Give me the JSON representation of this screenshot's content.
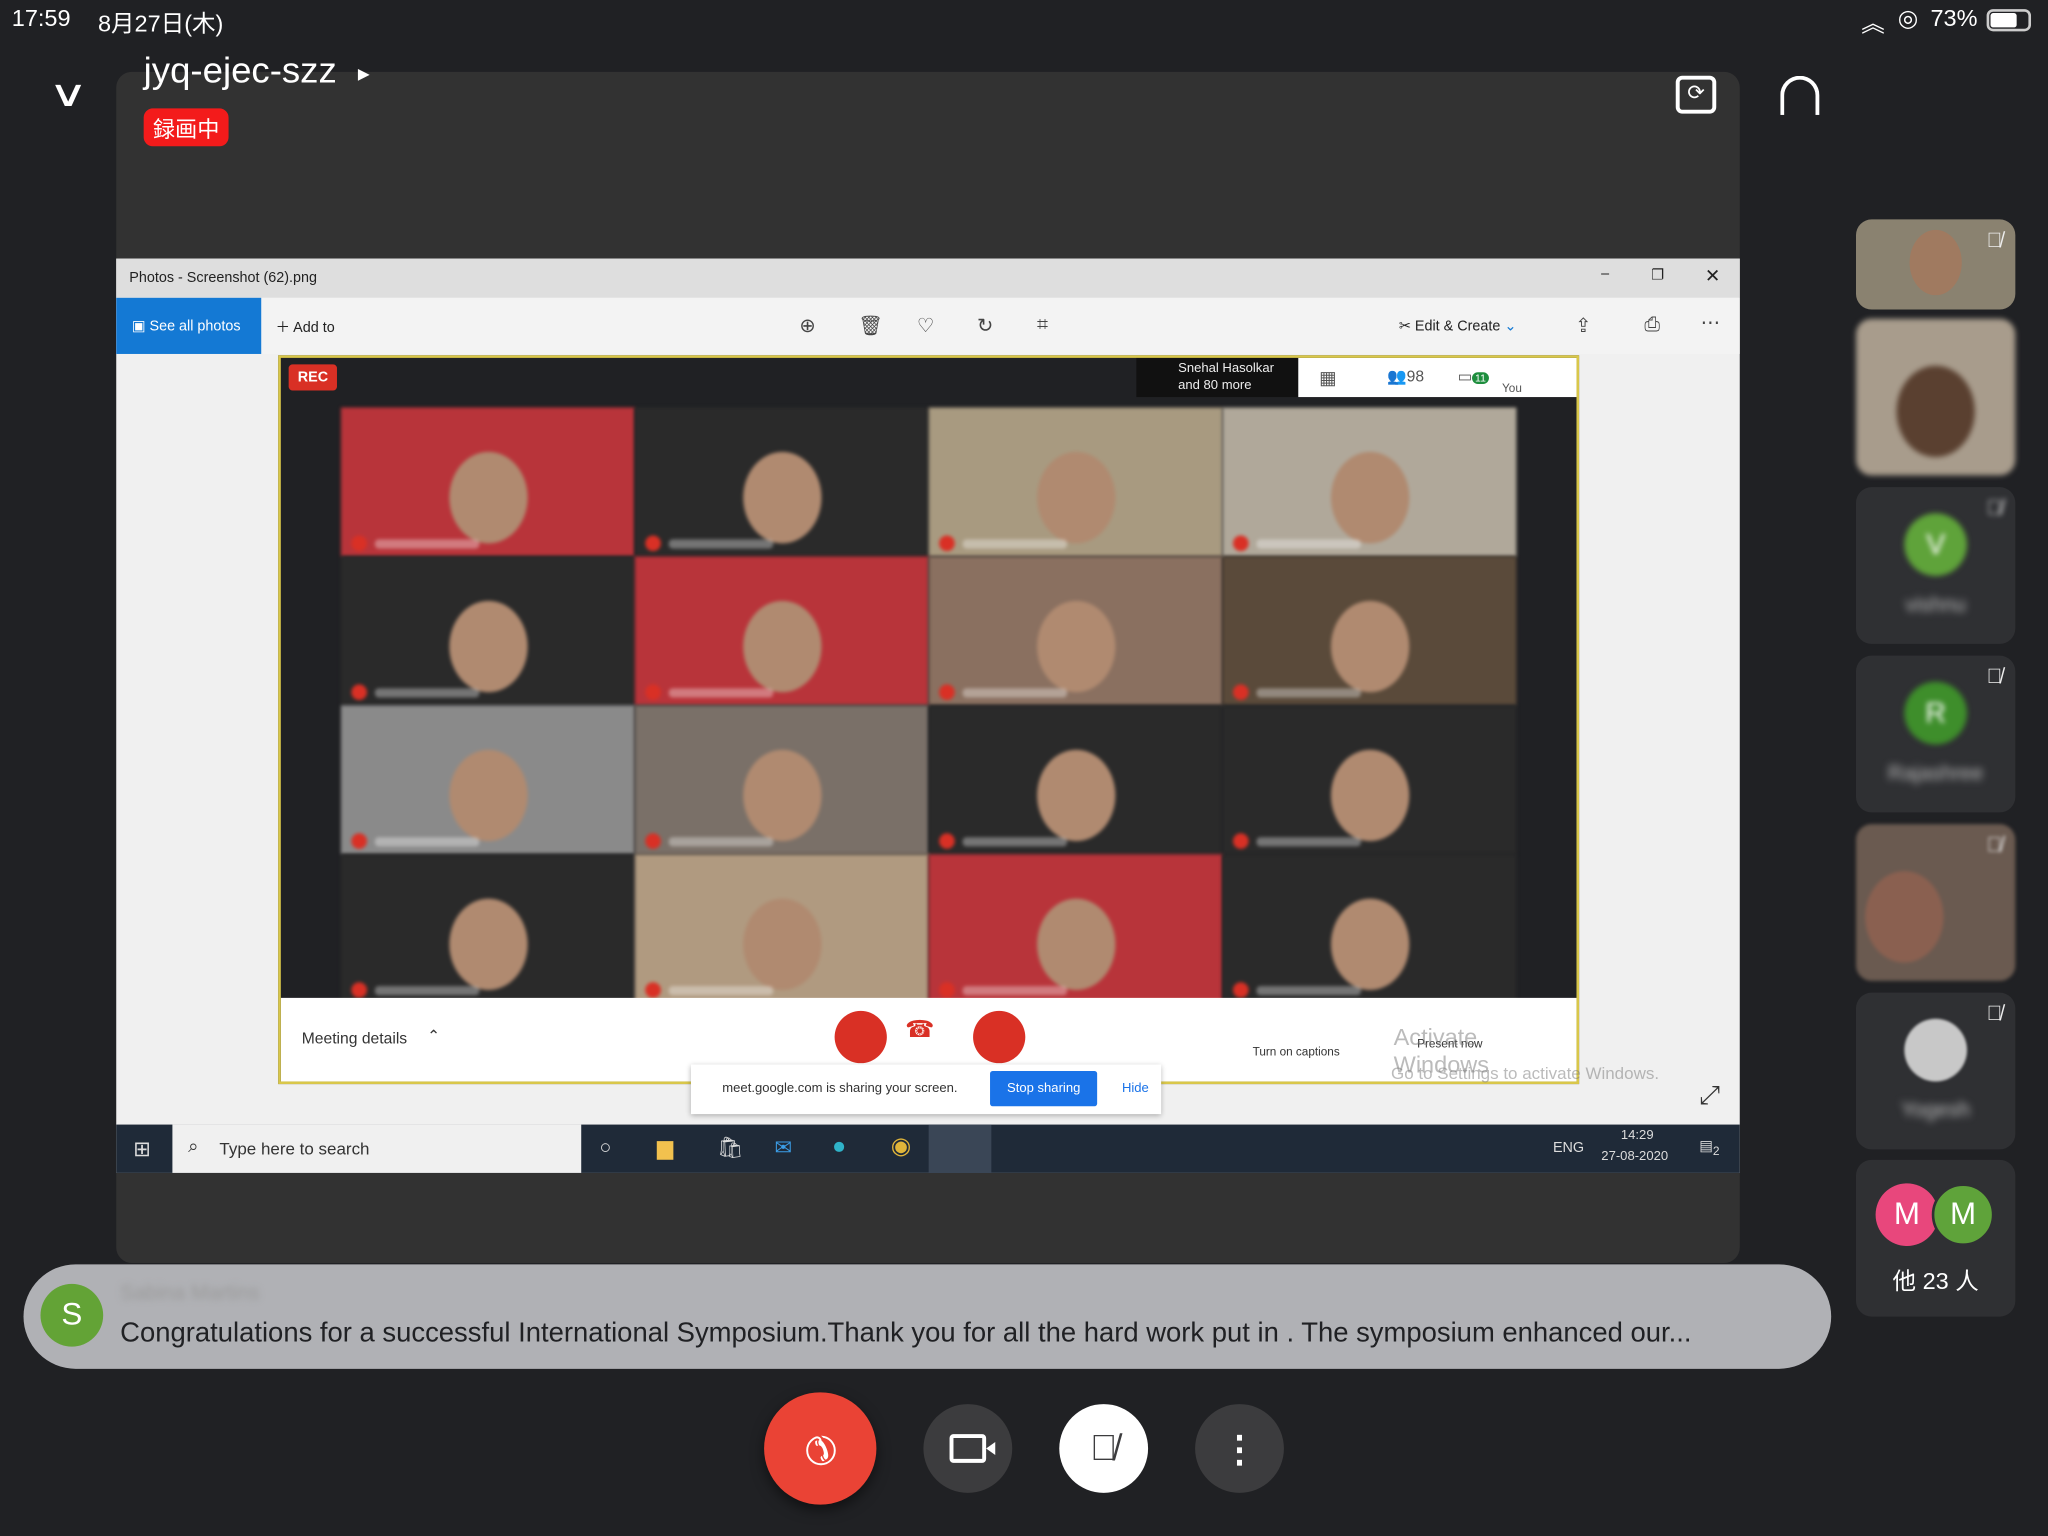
{
  "status_bar": {
    "time": "17:59",
    "date": "8月27日(木)",
    "battery": "73%"
  },
  "meeting": {
    "code": "jyq-ejec-szz",
    "recording_badge": "録画中"
  },
  "shared_screen": {
    "window_title": "Photos - Screenshot (62).png",
    "toolbar": {
      "see_all": "See all photos",
      "add_to": "Add to",
      "edit_create": "Edit & Create"
    },
    "meet": {
      "rec": "REC",
      "presenter": "Snehal Hasolkar",
      "presenter_more": "and 80 more",
      "people_count": "98",
      "chat_count": "11",
      "you": "You",
      "meeting_details": "Meeting details",
      "captions": "Turn on captions",
      "present": "Present now"
    },
    "sharing_bar": {
      "text": "meet.google.com is sharing your screen.",
      "stop": "Stop sharing",
      "hide": "Hide"
    },
    "activate": {
      "title": "Activate Windows",
      "sub": "Go to Settings to activate Windows."
    },
    "taskbar": {
      "search_placeholder": "Type here to search",
      "lang": "ENG",
      "clock_time": "14:29",
      "clock_date": "27-08-2020",
      "notif_count": "2"
    }
  },
  "participants": [
    {
      "name": "vishnu",
      "initial": "V",
      "color": "#5fa33a"
    },
    {
      "name": "Rajashree",
      "initial": "R",
      "color": "#3e8e2b"
    },
    {
      "name": "Yogesh"
    }
  ],
  "others": {
    "avatars": [
      {
        "initial": "M",
        "color": "#e8477c"
      },
      {
        "initial": "M",
        "color": "#5fa33a"
      }
    ],
    "label": "他 23 人"
  },
  "chat_toast": {
    "initial": "S",
    "color": "#63a336",
    "sender": "Sabina Martins",
    "message": "Congratulations for a successful International Symposium.Thank you for all the hard work put in . The symposium enhanced our..."
  },
  "controls": {
    "end_color": "#ea4335"
  }
}
